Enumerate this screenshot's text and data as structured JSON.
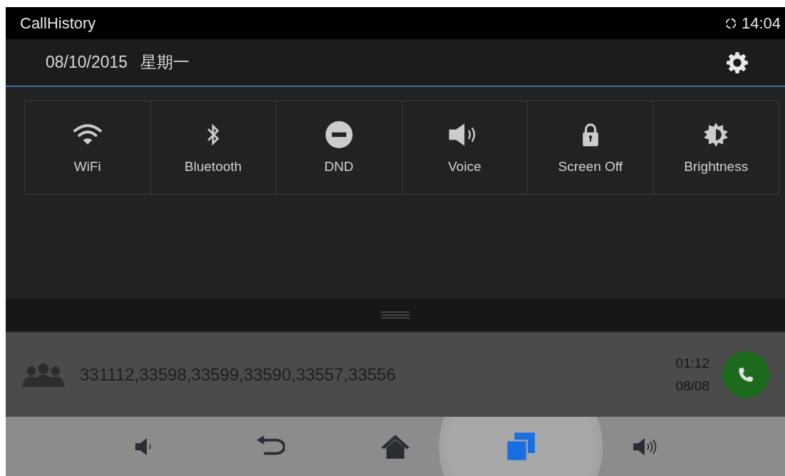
{
  "status_bar": {
    "app_title": "CallHistory",
    "time": "14:04"
  },
  "date_bar": {
    "date": "08/10/2015",
    "weekday": "星期一"
  },
  "quick_settings": [
    {
      "kind": "wifi",
      "label": "WiFi"
    },
    {
      "kind": "bluetooth",
      "label": "Bluetooth"
    },
    {
      "kind": "dnd",
      "label": "DND"
    },
    {
      "kind": "voice",
      "label": "Voice"
    },
    {
      "kind": "lock",
      "label": "Screen Off"
    },
    {
      "kind": "brightness",
      "label": "Brightness"
    }
  ],
  "notification": {
    "numbers": "331112,33598,33599,33590,33557,33556",
    "time": "01:12",
    "date": "08/08"
  },
  "nav_bar": [
    {
      "kind": "volume-down",
      "selected": false
    },
    {
      "kind": "back",
      "selected": false
    },
    {
      "kind": "home",
      "selected": false
    },
    {
      "kind": "recents",
      "selected": true
    },
    {
      "kind": "volume-up",
      "selected": false
    }
  ]
}
